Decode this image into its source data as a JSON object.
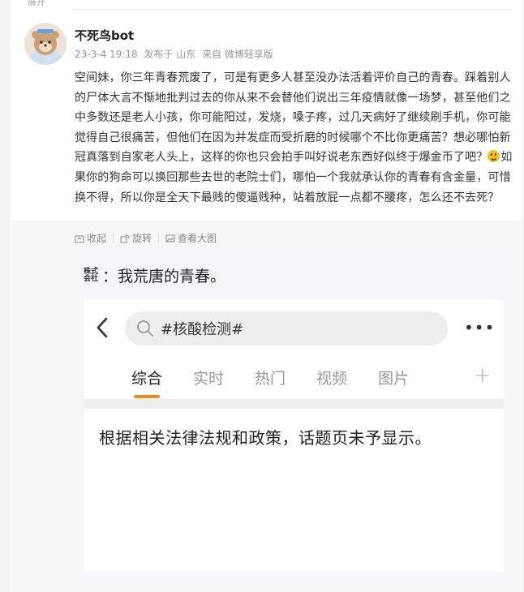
{
  "top_label": "展开",
  "user": {
    "name": "不死鸟bot",
    "timestamp": "23-3-4 19:18",
    "location": "发布于 山东",
    "source": "来自 微博轻享版"
  },
  "post": {
    "text_part1": "空间妹，你三年青春荒废了，可是有更多人甚至没办法活着评价自己的青春。踩着别人的尸体大言不惭地批判过去的你从来不会替他们说出三年疫情就像一场梦，甚至他们之中多数还是老人小孩，你可能阳过，发烧，嗓子疼，过几天病好了继续刷手机，你可能觉得自己很痛苦，但他们在因为并发症而受折磨的时候哪个不比你更痛苦？想必哪怕新冠真落到自家老人头上，这样的你也只会拍手叫好说老东西好似终于爆金币了吧？",
    "emoji_name": "smirk-emoji",
    "text_part2": "如果你的狗命可以换回那些去世的老院士们，哪怕一个我就承认你的青春有含金量，可惜换不得，所以你是全天下最贱的傻逼贱种，站着放屁一点都不腰疼，怎么还不去死？"
  },
  "toolbar": {
    "collapse": "收起",
    "rotate": "旋转",
    "view_large": "查看大图"
  },
  "image": {
    "badge_top": "株式",
    "badge_bottom": "会社",
    "caption": "：我荒唐的青春。",
    "search_text": "#核酸检测#",
    "more": "•••",
    "tabs": [
      "综合",
      "实时",
      "热门",
      "视频",
      "图片"
    ],
    "plus": "+",
    "notice": "根据相关法律法规和政策，话题页未予显示。"
  },
  "colors": {
    "accent": "#f08a1c",
    "emoji": "#f4c21f"
  }
}
